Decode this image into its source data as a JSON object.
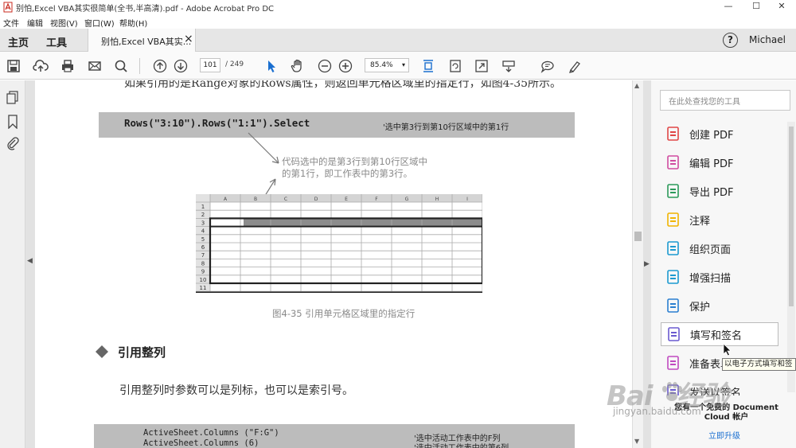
{
  "window": {
    "title": "别怕,Excel VBA其实很简单(全书,半高清).pdf - Adobe Acrobat Pro DC",
    "minimize": "—",
    "maximize": "☐",
    "close": "✕"
  },
  "menu": [
    "文件",
    "编辑",
    "视图(V)",
    "窗口(W)",
    "帮助(H)"
  ],
  "tabs": {
    "home": "主页",
    "tools": "工具",
    "document": "别怕,Excel VBA其实...",
    "close": "×",
    "help": "?",
    "user": "Michael"
  },
  "toolbar": {
    "page_current": "101",
    "page_total": "/ 249",
    "zoom": "85.4%"
  },
  "page": {
    "top_line": "如果引用的是Range对象的Rows属性，则返回单元格区域里的指定行，如图4-35所示。",
    "code1": "Rows(\"3:10\").Rows(\"1:1\").Select",
    "code1_comment": "'选中第3行到第10行区域中的第1行",
    "callout_line1": "代码选中的是第3行到第10行区域中",
    "callout_line2": "的第1行，即工作表中的第3行。",
    "col_headers": [
      "A",
      "B",
      "C",
      "D",
      "E",
      "F",
      "G",
      "H",
      "I"
    ],
    "row_headers": [
      "1",
      "2",
      "3",
      "4",
      "5",
      "6",
      "7",
      "8",
      "9",
      "10",
      "11"
    ],
    "figure_caption": "图4-35   引用单元格区域里的指定行",
    "section_heading": "引用整列",
    "body_text": "引用整列时参数可以是列标，也可以是索引号。",
    "code2_line1": "ActiveSheet.Columns (\"F:G\")",
    "code2_line1_comment": "'选中活动工作表中的F列",
    "code2_line2": "ActiveSheet.Columns (6)",
    "code2_line2_comment": "'选中活动工作表中的第6列"
  },
  "right_panel": {
    "search_placeholder": "在此处查找您的工具",
    "tools": [
      {
        "label": "创建 PDF",
        "color": "#e04646"
      },
      {
        "label": "编辑 PDF",
        "color": "#d04ca0"
      },
      {
        "label": "导出 PDF",
        "color": "#2b9a5a"
      },
      {
        "label": "注释",
        "color": "#f0b400"
      },
      {
        "label": "组织页面",
        "color": "#1c9ad0"
      },
      {
        "label": "增强扫描",
        "color": "#1c9ad0"
      },
      {
        "label": "保护",
        "color": "#2a7fd0"
      },
      {
        "label": "填写和签名",
        "color": "#6a5ad0"
      },
      {
        "label": "准备表单",
        "color": "#c04ac0"
      },
      {
        "label": "发送以签名",
        "color": "#6a5ad0"
      }
    ],
    "tooltip": "以电子方式填写和签",
    "promo_text": "您有一个免费的 Document Cloud 帐户",
    "upgrade_link": "立即升级"
  },
  "watermark": {
    "logo": "Baidu经验",
    "url": "jingyan.baidu.com"
  }
}
